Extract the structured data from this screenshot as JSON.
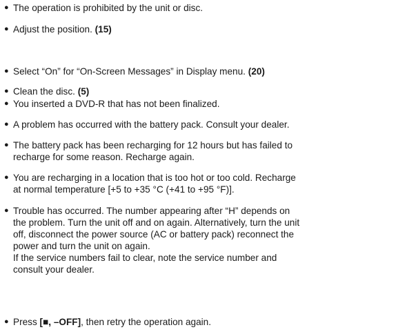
{
  "bullet": "●",
  "items": [
    {
      "lines": [
        {
          "text": "The operation is prohibited by the unit or disc.",
          "ref": ""
        }
      ]
    },
    {
      "lines": [
        {
          "text": "Adjust the position. ",
          "ref": "(15)"
        }
      ]
    },
    {
      "lines": [
        {
          "text": "Select “On” for “On-Screen Messages” in Display menu. ",
          "ref": "(20)"
        }
      ]
    },
    {
      "lines": [
        {
          "text": "Clean the disc. ",
          "ref": "(5)"
        }
      ]
    },
    {
      "lines": [
        {
          "text": "You inserted a DVD-R that has not been finalized.",
          "ref": ""
        }
      ]
    },
    {
      "lines": [
        {
          "text": "A problem has occurred with the battery pack. Consult your dealer.",
          "ref": ""
        }
      ]
    },
    {
      "lines": [
        {
          "text": "The battery pack has been recharging for 12 hours but has failed to",
          "ref": ""
        },
        {
          "text": "recharge for some reason. Recharge again.",
          "ref": ""
        }
      ]
    },
    {
      "lines": [
        {
          "text": "You are recharging in a location that is too hot or too cold. Recharge",
          "ref": ""
        },
        {
          "text": "at normal temperature [+5 to +35 °C (+41 to +95 °F)].",
          "ref": ""
        }
      ]
    },
    {
      "lines": [
        {
          "text": "Trouble has occurred. The number appearing after “H” depends on",
          "ref": ""
        },
        {
          "text": "the problem. Turn the unit off and on again. Alternatively, turn the unit",
          "ref": ""
        },
        {
          "text": "off, disconnect the power source (AC or battery pack) reconnect the",
          "ref": ""
        },
        {
          "text": "power and turn the unit on again.",
          "ref": ""
        },
        {
          "text": "If the service numbers fail to clear, note the service number and",
          "ref": ""
        },
        {
          "text": "consult your dealer.",
          "ref": ""
        }
      ]
    },
    {
      "lines": [
        {
          "text": "Press ",
          "ref": "[■, –OFF]",
          "after": ", then retry the operation again."
        }
      ]
    }
  ]
}
